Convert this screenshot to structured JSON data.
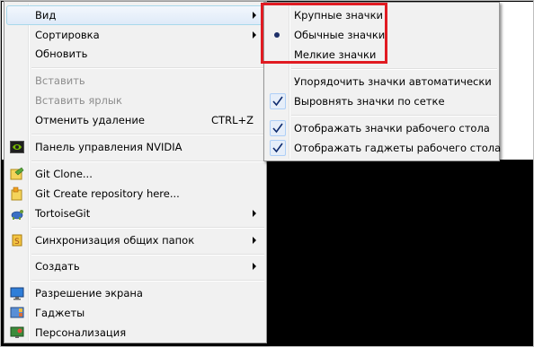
{
  "main_menu": {
    "items": [
      {
        "label": "Вид"
      },
      {
        "label": "Сортировка"
      },
      {
        "label": "Обновить"
      },
      {
        "label": "Вставить"
      },
      {
        "label": "Вставить ярлык"
      },
      {
        "label": "Отменить удаление",
        "shortcut": "CTRL+Z"
      },
      {
        "label": "Панель управления NVIDIA"
      },
      {
        "label": "Git Clone..."
      },
      {
        "label": "Git Create repository here..."
      },
      {
        "label": "TortoiseGit"
      },
      {
        "label": "Синхронизация общих папок"
      },
      {
        "label": "Создать"
      },
      {
        "label": "Разрешение экрана"
      },
      {
        "label": "Гаджеты"
      },
      {
        "label": "Персонализация"
      }
    ]
  },
  "view_submenu": {
    "items": [
      {
        "label": "Крупные значки"
      },
      {
        "label": "Обычные значки",
        "selected": true
      },
      {
        "label": "Мелкие значки"
      },
      {
        "label": "Упорядочить значки автоматически"
      },
      {
        "label": "Выровнять значки по сетке",
        "checked": true
      },
      {
        "label": "Отображать значки рабочего стола",
        "checked": true
      },
      {
        "label": "Отображать гаджеты  рабочего стола",
        "checked": true
      }
    ]
  },
  "colors": {
    "highlight_box": "#e11b22",
    "menu_background": "#f1f1f1",
    "desktop": "#000000"
  },
  "icons": {
    "nvidia": "nvidia-icon",
    "git_clone": "git-clone-icon",
    "git_create": "git-create-icon",
    "tortoisegit": "tortoisegit-icon",
    "sync": "sync-folders-icon",
    "resolution": "screen-resolution-icon",
    "gadgets": "gadgets-icon",
    "personalize": "personalization-icon"
  }
}
